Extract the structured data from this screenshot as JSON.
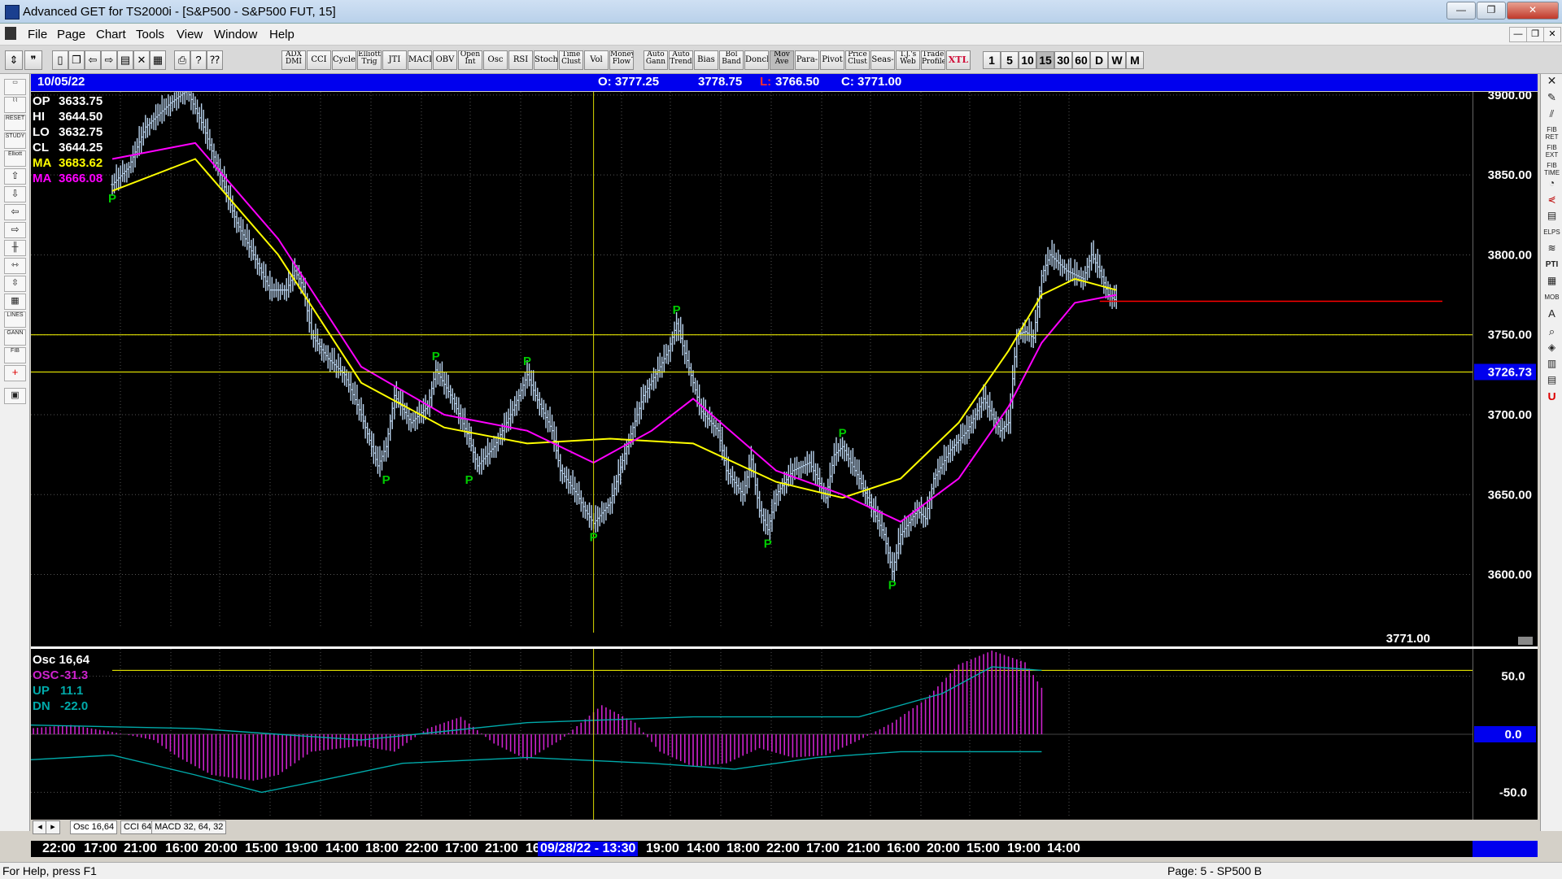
{
  "window": {
    "title": "Advanced GET for TS2000i - [S&P500 - S&P500 FUT, 15]",
    "controls": [
      "—",
      "❐",
      "✕"
    ]
  },
  "menu": {
    "items": [
      "File",
      "Page",
      "Chart",
      "Tools",
      "View",
      "Window",
      "Help"
    ]
  },
  "toolbar": {
    "study_buttons": [
      "ADX DMI",
      "CCI",
      "Cycles",
      "Elliott Trig",
      "JTI",
      "MACD",
      "OBV",
      "Open Int",
      "Osc",
      "RSI",
      "Stoch",
      "Time Clust",
      "Vol",
      "Money Flow",
      "Auto Gann",
      "Auto Trend",
      "Bias",
      "Bol Band",
      "Donch",
      "Mov Ave",
      "Para-bolic",
      "Pivot",
      "Price Clust",
      "Seas-onals",
      "T.J.'s Web",
      "Trade Profile",
      "XTL"
    ],
    "timeframes": [
      "1",
      "5",
      "10",
      "15",
      "30",
      "60",
      "D",
      "W",
      "M"
    ],
    "active_timeframe": "15"
  },
  "info_bar": {
    "date": "10/05/22",
    "open": "O: 3777.25",
    "high": "3778.75",
    "low_label": "L:",
    "low": "3766.50",
    "close": "C: 3771.00"
  },
  "data_window": {
    "op": {
      "label": "OP",
      "value": "3633.75"
    },
    "hi": {
      "label": "HI",
      "value": "3644.50"
    },
    "lo": {
      "label": "LO",
      "value": "3632.75"
    },
    "cl": {
      "label": "CL",
      "value": "3644.25"
    },
    "ma1": {
      "label": "MA",
      "value": "3683.62",
      "color": "#ffff00"
    },
    "ma2": {
      "label": "MA",
      "value": "3666.08",
      "color": "#ff00ff"
    }
  },
  "price_axis": {
    "labels": [
      "3900.00",
      "3850.00",
      "3800.00",
      "3750.00",
      "3700.00",
      "3650.00",
      "3600.00"
    ],
    "marker": "3726.73",
    "last_price": "3771.00",
    "ylim": [
      3555,
      3903
    ]
  },
  "oscillator": {
    "title": "Osc 16,64",
    "osc": {
      "label": "OSC",
      "value": "-31.3"
    },
    "up": {
      "label": "UP",
      "value": "11.1"
    },
    "dn": {
      "label": "DN",
      "value": "-22.0"
    },
    "axis_labels": [
      "50.0",
      "0.0",
      "-50.0"
    ]
  },
  "tabs": [
    "Osc 16,64",
    "CCI 64",
    "MACD 32, 64, 32"
  ],
  "time_axis": {
    "labels": [
      "22:00",
      "17:00",
      "21:00",
      "16:00",
      "20:00",
      "15:00",
      "19:00",
      "14:00",
      "18:00",
      "22:00",
      "17:00",
      "21:00",
      "16"
    ],
    "highlight": "09/28/22 - 13:30",
    "labels_after": [
      "19:00",
      "14:00",
      "18:00",
      "22:00",
      "17:00",
      "21:00",
      "16:00",
      "20:00",
      "15:00",
      "19:00",
      "14:00"
    ]
  },
  "status": {
    "help": "For Help, press F1",
    "page": "Page: 5 - SP500 B"
  },
  "pivot_label": "P",
  "colors": {
    "background": "#000000",
    "bars": "#b9d3ee",
    "ma_fast": "#ffff00",
    "ma_slow": "#ff00ff",
    "pivot": "#00cc00",
    "level_line": "#ffff00",
    "last_price_line": "#ff0000",
    "osc_hist": "#cc22cc",
    "osc_bands": "#00aaaa",
    "highlight": "#0000ee"
  },
  "chart_data": {
    "type": "candlestick",
    "symbol": "S&P500 FUT",
    "interval": "15",
    "ylim": [
      3555,
      3903
    ],
    "price_path": [
      [
        0,
        3844
      ],
      [
        2,
        3855
      ],
      [
        4,
        3880
      ],
      [
        7,
        3895
      ],
      [
        9,
        3903
      ],
      [
        11,
        3880
      ],
      [
        13,
        3850
      ],
      [
        15,
        3820
      ],
      [
        17,
        3800
      ],
      [
        19,
        3778
      ],
      [
        21,
        3778
      ],
      [
        22,
        3790
      ],
      [
        23,
        3780
      ],
      [
        24,
        3750
      ],
      [
        26,
        3735
      ],
      [
        28,
        3725
      ],
      [
        30,
        3700
      ],
      [
        32,
        3668
      ],
      [
        33,
        3680
      ],
      [
        34,
        3712
      ],
      [
        36,
        3695
      ],
      [
        38,
        3705
      ],
      [
        39,
        3728
      ],
      [
        41,
        3710
      ],
      [
        43,
        3685
      ],
      [
        44,
        3668
      ],
      [
        46,
        3680
      ],
      [
        48,
        3700
      ],
      [
        49,
        3712
      ],
      [
        50,
        3725
      ],
      [
        51,
        3712
      ],
      [
        53,
        3690
      ],
      [
        54,
        3665
      ],
      [
        56,
        3650
      ],
      [
        57,
        3640
      ],
      [
        58,
        3632
      ],
      [
        60,
        3645
      ],
      [
        62,
        3680
      ],
      [
        64,
        3712
      ],
      [
        66,
        3730
      ],
      [
        67,
        3740
      ],
      [
        68,
        3757
      ],
      [
        70,
        3720
      ],
      [
        71,
        3702
      ],
      [
        73,
        3690
      ],
      [
        74,
        3665
      ],
      [
        76,
        3650
      ],
      [
        77,
        3672
      ],
      [
        78,
        3640
      ],
      [
        79,
        3628
      ],
      [
        80,
        3650
      ],
      [
        82,
        3665
      ],
      [
        84,
        3670
      ],
      [
        85,
        3660
      ],
      [
        86,
        3648
      ],
      [
        87,
        3675
      ],
      [
        88,
        3680
      ],
      [
        90,
        3660
      ],
      [
        91,
        3648
      ],
      [
        93,
        3625
      ],
      [
        94,
        3602
      ],
      [
        95,
        3625
      ],
      [
        97,
        3640
      ],
      [
        98,
        3635
      ],
      [
        99,
        3660
      ],
      [
        101,
        3678
      ],
      [
        103,
        3690
      ],
      [
        105,
        3710
      ],
      [
        106,
        3700
      ],
      [
        107,
        3690
      ],
      [
        108,
        3695
      ],
      [
        109,
        3750
      ],
      [
        110,
        3752
      ],
      [
        111,
        3748
      ],
      [
        112,
        3787
      ],
      [
        113,
        3800
      ],
      [
        115,
        3790
      ],
      [
        117,
        3785
      ],
      [
        118,
        3800
      ],
      [
        119,
        3790
      ],
      [
        120,
        3775
      ],
      [
        121,
        3771
      ]
    ],
    "ma_fast": [
      [
        0,
        3840
      ],
      [
        10,
        3860
      ],
      [
        20,
        3800
      ],
      [
        30,
        3720
      ],
      [
        40,
        3692
      ],
      [
        50,
        3682
      ],
      [
        60,
        3685
      ],
      [
        70,
        3682
      ],
      [
        80,
        3658
      ],
      [
        88,
        3648
      ],
      [
        95,
        3660
      ],
      [
        102,
        3695
      ],
      [
        108,
        3740
      ],
      [
        112,
        3775
      ],
      [
        116,
        3785
      ],
      [
        121,
        3778
      ]
    ],
    "ma_slow": [
      [
        0,
        3860
      ],
      [
        10,
        3870
      ],
      [
        20,
        3810
      ],
      [
        30,
        3730
      ],
      [
        40,
        3700
      ],
      [
        50,
        3690
      ],
      [
        58,
        3670
      ],
      [
        65,
        3690
      ],
      [
        70,
        3710
      ],
      [
        80,
        3665
      ],
      [
        88,
        3650
      ],
      [
        95,
        3633
      ],
      [
        102,
        3660
      ],
      [
        108,
        3705
      ],
      [
        112,
        3745
      ],
      [
        116,
        3770
      ],
      [
        121,
        3775
      ]
    ],
    "pivots": [
      [
        0,
        "low",
        3844
      ],
      [
        33,
        "low",
        3668
      ],
      [
        39,
        "high",
        3728
      ],
      [
        43,
        "low",
        3668
      ],
      [
        50,
        "high",
        3725
      ],
      [
        58,
        "low",
        3632
      ],
      [
        68,
        "high",
        3757
      ],
      [
        79,
        "low",
        3628
      ],
      [
        88,
        "high",
        3680
      ],
      [
        94,
        "low",
        3602
      ]
    ],
    "levels": {
      "yellow_1": 3750,
      "yellow_2": 3726.73,
      "red": 3771
    },
    "cursor_index": 58,
    "bar_count": 166,
    "oscillator": {
      "name": "Osc 16,64",
      "ylim": [
        -70,
        70
      ],
      "upper_band": 55,
      "osc_path": [
        [
          0,
          5
        ],
        [
          5,
          8
        ],
        [
          10,
          2
        ],
        [
          15,
          -5
        ],
        [
          18,
          -20
        ],
        [
          22,
          -35
        ],
        [
          27,
          -40
        ],
        [
          30,
          -35
        ],
        [
          34,
          -15
        ],
        [
          40,
          -10
        ],
        [
          44,
          -15
        ],
        [
          48,
          5
        ],
        [
          52,
          15
        ],
        [
          56,
          -8
        ],
        [
          60,
          -22
        ],
        [
          64,
          -5
        ],
        [
          69,
          25
        ],
        [
          73,
          10
        ],
        [
          76,
          -15
        ],
        [
          80,
          -28
        ],
        [
          84,
          -25
        ],
        [
          88,
          -12
        ],
        [
          92,
          -20
        ],
        [
          96,
          -18
        ],
        [
          100,
          -5
        ],
        [
          104,
          10
        ],
        [
          108,
          30
        ],
        [
          112,
          60
        ],
        [
          116,
          72
        ],
        [
          120,
          62
        ],
        [
          122,
          40
        ]
      ],
      "up_path": [
        [
          0,
          8
        ],
        [
          20,
          5
        ],
        [
          40,
          -5
        ],
        [
          60,
          10
        ],
        [
          80,
          15
        ],
        [
          100,
          15
        ],
        [
          110,
          35
        ],
        [
          116,
          58
        ],
        [
          122,
          55
        ]
      ],
      "dn_path": [
        [
          0,
          -22
        ],
        [
          10,
          -18
        ],
        [
          20,
          -35
        ],
        [
          28,
          -50
        ],
        [
          35,
          -40
        ],
        [
          45,
          -25
        ],
        [
          60,
          -20
        ],
        [
          75,
          -25
        ],
        [
          85,
          -30
        ],
        [
          95,
          -20
        ],
        [
          105,
          -15
        ],
        [
          122,
          -15
        ]
      ]
    }
  }
}
